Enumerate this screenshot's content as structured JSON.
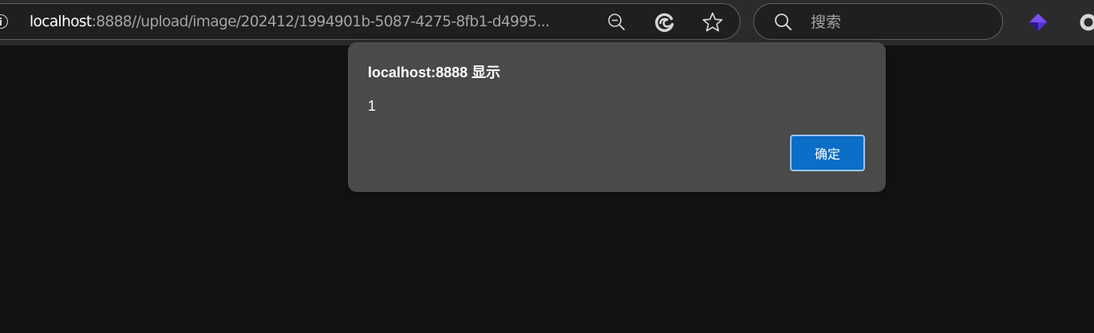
{
  "browser": {
    "address_bar": {
      "url_host": "localhost",
      "url_rest": ":8888//upload/image/202412/1994901b-5087-4275-8fb1-d4995..."
    },
    "toolbar_icons": [
      "info-icon",
      "zoom-out-icon",
      "refresh-icon",
      "favorite-star-icon",
      "search-icon",
      "extension-icon"
    ],
    "search": {
      "placeholder": "搜索"
    },
    "colors": {
      "toolbar_bg": "#2b2b2b",
      "page_bg": "#121212",
      "dialog_bg": "#4a4a4a",
      "button_accent": "#0b6ec7",
      "extension_icon": "#5b2fd6"
    }
  },
  "dialog": {
    "title": "localhost:8888 显示",
    "message": "1",
    "ok_label": "确定"
  }
}
